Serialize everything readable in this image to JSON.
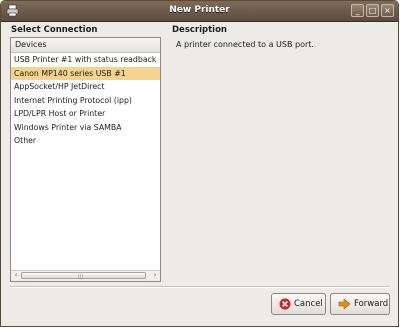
{
  "window": {
    "title": "New Printer",
    "icon": "printer-icon"
  },
  "controls": {
    "minimize": "_",
    "maximize": "□",
    "close": "×"
  },
  "left": {
    "heading": "Select Connection",
    "column_header": "Devices",
    "items": [
      "USB Printer #1 with status readback",
      "Canon MP140 series USB #1",
      "AppSocket/HP JetDirect",
      "Internet Printing Protocol (ipp)",
      "LPD/LPR Host or Printer",
      "Windows Printer via SAMBA",
      "Other"
    ],
    "selected_index": 1,
    "scroll": {
      "left_arrow": "‹",
      "right_arrow": "›",
      "grip": "|||"
    }
  },
  "right": {
    "heading": "Description",
    "description": "A printer connected to a USB port."
  },
  "buttons": {
    "cancel": "Cancel",
    "forward": "Forward"
  },
  "colors": {
    "titlebar": "#6b5a49",
    "selection": "#f6d38c",
    "cancel_icon": "#d42020",
    "forward_icon": "#e88a1a"
  }
}
